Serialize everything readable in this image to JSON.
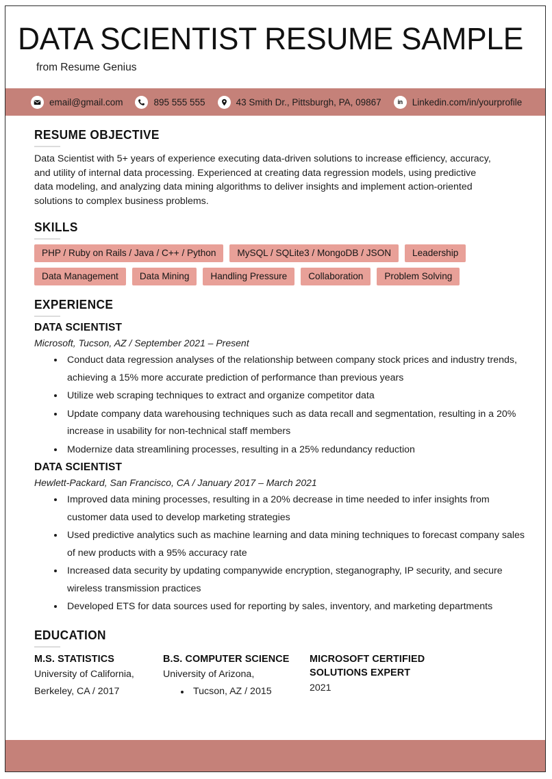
{
  "document": {
    "title": "DATA SCIENTIST RESUME SAMPLE",
    "subtitle": "from Resume Genius"
  },
  "theme": {
    "bar_color": "#c58179",
    "pill_color": "#e8a098",
    "text_color": "#1c1c1c",
    "rule_color": "#dcdcdc"
  },
  "contact": [
    {
      "icon": "envelope-icon",
      "text": "email@gmail.com"
    },
    {
      "icon": "phone-icon",
      "text": "895 555 555"
    },
    {
      "icon": "map-pin-icon",
      "text": "43 Smith Dr., Pittsburgh, PA, 09867"
    },
    {
      "icon": "linkedin-icon",
      "text": "Linkedin.com/in/yourprofile"
    }
  ],
  "objective": {
    "heading": "RESUME OBJECTIVE",
    "text": "Data Scientist with 5+ years of experience executing data-driven solutions to increase efficiency, accuracy, and utility of internal data processing. Experienced at creating data regression models, using predictive data modeling, and analyzing data mining algorithms to deliver insights and implement action-oriented solutions to complex business problems."
  },
  "skills": {
    "heading": "SKILLS",
    "rows": [
      [
        "PHP / Ruby on Rails / Java / C++ / Python",
        "MySQL / SQLite3 / MongoDB / JSON",
        "Leadership"
      ],
      [
        "Data Management",
        "Data Mining",
        "Handling Pressure",
        "Collaboration",
        "Problem Solving"
      ]
    ]
  },
  "experience": {
    "heading": "EXPERIENCE",
    "jobs": [
      {
        "title": "DATA SCIENTIST",
        "meta": "Microsoft, Tucson, AZ  /  September 2021 – Present",
        "bullets": [
          "Conduct data regression analyses of the relationship between company stock prices and industry trends, achieving a 15% more accurate prediction of performance than previous years",
          "Utilize web scraping techniques to extract and organize competitor data",
          "Update company data warehousing techniques such as data recall and segmentation, resulting in a 20% increase in usability for non-technical staff members",
          "Modernize data streamlining processes, resulting in a 25% redundancy reduction"
        ]
      },
      {
        "title": "DATA SCIENTIST",
        "meta": "Hewlett-Packard, San Francisco, CA  /  January 2017 – March 2021",
        "bullets": [
          "Improved data mining processes, resulting in a 20% decrease in time needed to infer insights from customer data used to develop marketing strategies",
          "Used predictive analytics such as machine learning and data mining techniques to forecast company sales of new products with a 95% accuracy rate",
          "Increased data security by updating companywide encryption, steganography, IP security, and secure wireless transmission practices",
          "Developed ETS for data sources used for reporting by sales, inventory, and marketing departments"
        ]
      }
    ]
  },
  "education": {
    "heading": "EDUCATION",
    "columns": [
      {
        "degree": "M.S. STATISTICS",
        "lines": [
          "University of California,",
          "Berkeley, CA  /  2017"
        ],
        "bullets": []
      },
      {
        "degree": "B.S. COMPUTER SCIENCE",
        "lines": [
          "University of Arizona,"
        ],
        "bullets": [
          "Tucson, AZ  /  2015"
        ]
      },
      {
        "degree": "MICROSOFT CERTIFIED SOLUTIONS EXPERT",
        "lines": [
          "2021"
        ],
        "bullets": []
      }
    ]
  }
}
